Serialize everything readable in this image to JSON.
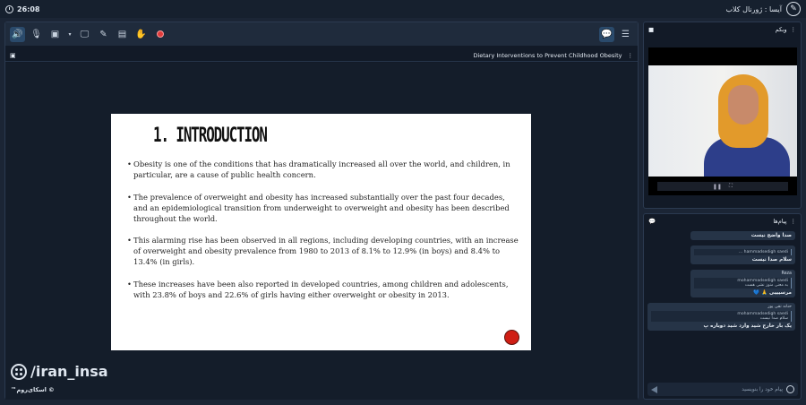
{
  "topbar": {
    "time": "26:08",
    "app_title": "آیسا : ژورنال کلاب"
  },
  "toolbar": {
    "icons": [
      "speaker-icon",
      "mic-off-icon",
      "camera-off-icon",
      "screen-share-icon",
      "pen-icon",
      "folder-icon",
      "hand-icon",
      "record-icon",
      "chat-icon",
      "menu-icon"
    ]
  },
  "presentation": {
    "title": "Dietary Interventions to Prevent Childhood Obesity",
    "slide": {
      "heading": "1. INTRODUCTION",
      "bullets": [
        "Obesity is one of the conditions that has dramatically increased all over the world, and children, in particular, are a cause of public health concern.",
        "The prevalence of overweight and obesity has increased substantially over the past four decades, and an epidemiological transition from underweight to overweight and obesity has been described throughout the world.",
        "This alarming rise has been observed in all regions, including developing countries, with an increase of overweight and obesity prevalence from 1980 to 2013 of 8.1% to 12.9% (in boys) and 8.4% to 13.4% (in girls).",
        "These increases have been also reported in developed countries, among children and adolescents, with 23.8% of boys and 22.6% of girls having either overweight or obesity in 2013."
      ]
    },
    "watermark": "/iran_insa",
    "brand": "™اسکای‌روم ©"
  },
  "webcam": {
    "title": "وبکم"
  },
  "chat": {
    "title": "پیام‌ها",
    "messages": [
      {
        "name": "",
        "quote": "",
        "quote_text": "",
        "text": "صدا واضح نیست"
      },
      {
        "name": "",
        "quote": "hammadsedigh saedi ...",
        "quote_text": "",
        "text": "سلام صدا نیست"
      },
      {
        "name": "Reza",
        "quote": "mohammadsedigh saedi",
        "quote_text": "به معنی متوز نشی هست",
        "text": "مرسیییی 🙏 💙"
      },
      {
        "name": "حنانه تقی پور",
        "quote": "mohammadsedigh saedi",
        "quote_text": "سلام صدا نیست",
        "text": "یک بار خارج شید وارد شید دوباره پ"
      }
    ],
    "input_placeholder": "پیام خود را بنویسید"
  }
}
